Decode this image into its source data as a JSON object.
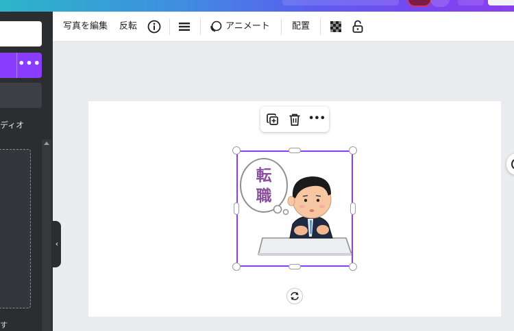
{
  "header": {
    "accent_gradient": [
      "#2bb6c9",
      "#5b5ef0",
      "#8a3ff0"
    ]
  },
  "left_panel": {
    "more_button_label": "•••",
    "audio_tab_label": "ディオ",
    "bottom_label": "す",
    "collapse_glyph": "‹"
  },
  "toolbar": {
    "edit_photo_label": "写真を編集",
    "flip_label": "反転",
    "info_icon": "info-icon",
    "lines_icon": "menu-lines-icon",
    "animate_label": "アニメート",
    "position_label": "配置",
    "transparency_icon": "transparency-checker-icon",
    "lock_icon": "lock-icon"
  },
  "context_toolbar": {
    "duplicate_icon": "duplicate-icon",
    "delete_icon": "trash-icon",
    "more_label": "•••"
  },
  "canvas": {
    "selected_image": {
      "bubble_text_1": "転",
      "bubble_text_2": "職"
    },
    "rotate_icon": "rotate-icon"
  },
  "colors": {
    "selection": "#8b3dff",
    "purple_button": "#8b3dff",
    "left_panel_bg": "#2b2d31",
    "canvas_bg": "#ebecf0"
  }
}
